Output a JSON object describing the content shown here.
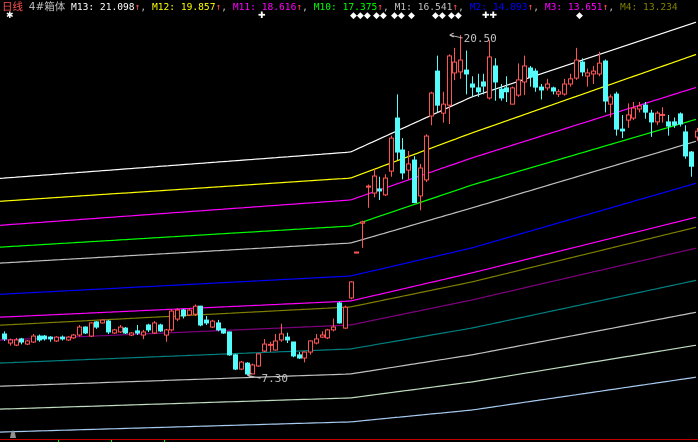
{
  "header": {
    "period": "日线",
    "indicator": "4#箱体",
    "arrow": "↑",
    "sep": ", ",
    "colors": {
      "period": "#ff5050",
      "indicator": "#c0c0c0",
      "arrow": "#ff5050"
    }
  },
  "markers": [
    "✱",
    "✚",
    "◆◆◆",
    "◆◆",
    "◆◆",
    "◆",
    "◆◆",
    "◆◆",
    "✚✚",
    "◆"
  ],
  "chart_data": {
    "type": "candlestick",
    "title": "日线 4#箱体",
    "ylim": [
      4.71,
      21.86
    ],
    "up_color": "#ff5454",
    "down_color": "#54fcfc",
    "annotations": [
      {
        "label": "20.50",
        "index": 77,
        "price": 20.5
      },
      {
        "label": "7.30",
        "index": 42,
        "price": 7.3
      }
    ],
    "candles": [
      [
        8.9,
        8.71,
        9.0,
        8.63
      ],
      [
        8.55,
        8.67,
        8.72,
        8.45
      ],
      [
        8.47,
        8.67,
        8.75,
        8.43
      ],
      [
        8.71,
        8.59,
        8.75,
        8.5
      ],
      [
        8.51,
        8.63,
        8.67,
        8.47
      ],
      [
        8.59,
        8.82,
        8.9,
        8.55
      ],
      [
        8.82,
        8.67,
        8.88,
        8.6
      ],
      [
        8.82,
        8.71,
        8.86,
        8.65
      ],
      [
        8.78,
        8.71,
        8.82,
        8.6
      ],
      [
        8.63,
        8.78,
        8.82,
        8.59
      ],
      [
        8.78,
        8.71,
        8.84,
        8.65
      ],
      [
        8.67,
        8.78,
        8.82,
        8.63
      ],
      [
        8.75,
        8.86,
        8.9,
        8.71
      ],
      [
        8.86,
        9.17,
        9.25,
        8.8
      ],
      [
        9.17,
        8.94,
        9.2,
        8.9
      ],
      [
        8.82,
        9.33,
        9.36,
        8.78
      ],
      [
        9.37,
        9.17,
        9.4,
        9.1
      ],
      [
        9.33,
        9.44,
        9.48,
        9.3
      ],
      [
        9.4,
        8.98,
        9.45,
        8.9
      ],
      [
        8.94,
        9.06,
        9.1,
        8.9
      ],
      [
        8.98,
        9.17,
        9.25,
        8.94
      ],
      [
        9.13,
        8.94,
        9.17,
        8.9
      ],
      [
        8.86,
        8.94,
        8.98,
        8.82
      ],
      [
        9.02,
        8.94,
        9.25,
        8.86
      ],
      [
        8.86,
        8.98,
        9.06,
        8.7
      ],
      [
        9.25,
        9.06,
        9.3,
        8.98
      ],
      [
        8.94,
        9.33,
        9.4,
        8.9
      ],
      [
        9.25,
        9.02,
        9.3,
        8.98
      ],
      [
        8.86,
        9.06,
        9.1,
        8.6
      ],
      [
        9.06,
        9.79,
        9.85,
        9.0
      ],
      [
        9.48,
        9.83,
        9.9,
        9.4
      ],
      [
        9.83,
        9.6,
        9.87,
        9.5
      ],
      [
        9.64,
        9.83,
        9.9,
        9.6
      ],
      [
        9.67,
        9.98,
        10.05,
        9.6
      ],
      [
        9.98,
        9.25,
        10.0,
        9.2
      ],
      [
        9.44,
        9.33,
        9.6,
        9.25
      ],
      [
        9.17,
        9.4,
        9.45,
        9.13
      ],
      [
        9.33,
        9.06,
        9.45,
        9.0
      ],
      [
        9.1,
        8.94,
        9.1,
        8.9
      ],
      [
        8.98,
        8.09,
        9.0,
        8.05
      ],
      [
        8.09,
        7.54,
        8.13,
        7.5
      ],
      [
        7.54,
        7.81,
        7.86,
        7.5
      ],
      [
        7.77,
        7.35,
        7.81,
        7.3
      ],
      [
        7.35,
        7.7,
        7.75,
        7.33
      ],
      [
        7.66,
        8.13,
        8.15,
        7.62
      ],
      [
        8.24,
        8.51,
        8.7,
        8.2
      ],
      [
        8.47,
        8.5,
        8.6,
        8.2
      ],
      [
        8.28,
        8.63,
        8.9,
        8.25
      ],
      [
        8.67,
        8.9,
        9.3,
        8.6
      ],
      [
        8.78,
        8.67,
        8.95,
        8.55
      ],
      [
        8.59,
        8.05,
        8.6,
        8.0
      ],
      [
        8.09,
        7.97,
        8.2,
        7.93
      ],
      [
        7.97,
        8.2,
        8.22,
        7.8
      ],
      [
        8.2,
        8.63,
        8.66,
        8.1
      ],
      [
        8.55,
        8.71,
        8.9,
        8.5
      ],
      [
        8.78,
        8.86,
        9.0,
        8.75
      ],
      [
        8.75,
        9.06,
        9.1,
        8.7
      ],
      [
        9.06,
        9.17,
        9.5,
        9.0
      ],
      [
        10.1,
        9.33,
        10.15,
        9.3
      ],
      [
        9.13,
        9.94,
        10.0,
        9.1
      ],
      [
        10.3,
        10.92,
        10.95,
        10.25
      ],
      [
        12.06,
        12.08,
        12.1,
        12.04
      ],
      [
        13.2,
        13.25,
        13.3,
        12.24
      ],
      [
        14.6,
        14.64,
        14.7,
        13.8
      ],
      [
        14.37,
        15.03,
        15.3,
        14.2
      ],
      [
        14.53,
        14.45,
        15.0,
        14.1
      ],
      [
        14.3,
        14.95,
        15.1,
        14.25
      ],
      [
        15.22,
        16.5,
        16.6,
        15.0
      ],
      [
        17.28,
        15.96,
        18.2,
        15.65
      ],
      [
        16.04,
        15.15,
        16.5,
        14.9
      ],
      [
        15.26,
        15.5,
        16.0,
        14.9
      ],
      [
        15.65,
        14.0,
        15.8,
        13.98
      ],
      [
        14.26,
        15.34,
        15.5,
        13.7
      ],
      [
        14.88,
        16.58,
        16.65,
        14.8
      ],
      [
        17.36,
        18.25,
        18.3,
        17.0
      ],
      [
        19.1,
        17.78,
        19.7,
        17.5
      ],
      [
        17.47,
        17.82,
        18.3,
        17.1
      ],
      [
        17.78,
        19.69,
        19.75,
        17.05
      ],
      [
        19.03,
        19.45,
        20.0,
        18.75
      ],
      [
        19.07,
        19.53,
        20.5,
        18.8
      ],
      [
        19.14,
        18.99,
        19.9,
        18.2
      ],
      [
        18.6,
        18.48,
        18.9,
        18.1
      ],
      [
        18.45,
        18.3,
        19.0,
        18.1
      ],
      [
        18.68,
        18.52,
        19.0,
        18.2
      ],
      [
        18.06,
        19.65,
        20.3,
        18.0
      ],
      [
        19.3,
        18.68,
        19.6,
        17.95
      ],
      [
        18.4,
        18.06,
        18.6,
        17.95
      ],
      [
        18.45,
        18.3,
        18.9,
        17.9
      ],
      [
        17.82,
        18.45,
        18.5,
        17.8
      ],
      [
        18.17,
        18.76,
        19.4,
        18.1
      ],
      [
        18.68,
        19.3,
        19.7,
        18.17
      ],
      [
        19.22,
        18.87,
        19.3,
        18.5
      ],
      [
        19.1,
        18.48,
        19.2,
        18.3
      ],
      [
        18.48,
        18.37,
        18.6,
        18.0
      ],
      [
        18.45,
        18.6,
        18.8,
        18.35
      ],
      [
        18.45,
        18.33,
        18.5,
        18.2
      ],
      [
        18.21,
        18.3,
        18.4,
        18.1
      ],
      [
        18.21,
        18.6,
        18.8,
        18.15
      ],
      [
        18.6,
        18.8,
        19.0,
        18.5
      ],
      [
        18.83,
        19.53,
        20.0,
        18.76
      ],
      [
        19.45,
        19.07,
        19.6,
        18.9
      ],
      [
        18.91,
        19.03,
        19.2,
        18.5
      ],
      [
        18.99,
        19.1,
        19.3,
        18.6
      ],
      [
        18.99,
        19.41,
        19.85,
        18.9
      ],
      [
        19.49,
        17.94,
        19.55,
        17.5
      ],
      [
        17.82,
        18.1,
        18.2,
        17.3
      ],
      [
        18.21,
        16.85,
        18.3,
        16.6
      ],
      [
        16.85,
        16.78,
        17.4,
        16.5
      ],
      [
        17.2,
        17.4,
        17.85,
        16.9
      ],
      [
        17.28,
        17.67,
        17.9,
        17.2
      ],
      [
        17.63,
        17.75,
        17.9,
        17.5
      ],
      [
        17.78,
        17.51,
        17.9,
        17.25
      ],
      [
        17.47,
        17.13,
        17.6,
        16.55
      ],
      [
        17.13,
        17.47,
        17.55,
        17.0
      ],
      [
        17.39,
        17.42,
        17.7,
        17.1
      ],
      [
        17.13,
        16.97,
        17.4,
        16.6
      ],
      [
        17.13,
        17.01,
        17.3,
        16.9
      ],
      [
        17.44,
        17.05,
        17.5,
        16.95
      ],
      [
        16.74,
        15.81,
        17.0,
        15.7
      ],
      [
        15.96,
        15.41,
        16.0,
        15.0
      ],
      [
        16.54,
        16.77,
        16.9,
        16.4
      ]
    ],
    "line_knot_indices": [
      0,
      60,
      81,
      120
    ],
    "series": [
      {
        "name": "M13",
        "value": "21.098",
        "color": "#ffffff",
        "values": [
          14.95,
          15.96,
          18.1,
          21.01
        ]
      },
      {
        "name": "M12",
        "value": "19.857",
        "color": "#ffff00",
        "values": [
          14.06,
          14.95,
          16.7,
          19.76
        ]
      },
      {
        "name": "M11",
        "value": "18.616",
        "color": "#ff00ff",
        "values": [
          13.13,
          14.1,
          15.73,
          18.48
        ]
      },
      {
        "name": "M10",
        "value": "17.375",
        "color": "#00ff00",
        "values": [
          12.28,
          13.09,
          14.68,
          17.24
        ]
      },
      {
        "name": "M1",
        "value": "16.541",
        "color": "#c0c0c0",
        "values": [
          11.66,
          12.43,
          13.79,
          16.39
        ]
      },
      {
        "name": "M2",
        "value": "14.893",
        "color": "#0000ff",
        "values": [
          10.45,
          11.15,
          12.24,
          14.76
        ]
      },
      {
        "name": "M3",
        "value": "13.651",
        "color": "#ff00ff",
        "values": [
          9.56,
          10.18,
          11.27,
          13.44
        ]
      },
      {
        "name": "M4",
        "value": "13.234",
        "color": "#808000",
        "values": [
          9.25,
          9.95,
          10.92,
          13.05
        ]
      },
      {
        "name": "M5",
        "color": "#800080",
        "values": [
          8.67,
          9.25,
          10.22,
          12.24
        ]
      },
      {
        "name": "M6",
        "color": "#008080",
        "values": [
          7.78,
          8.32,
          9.13,
          10.99
        ]
      },
      {
        "name": "M7",
        "color": "#c0c0c0",
        "values": [
          6.88,
          7.35,
          8.09,
          9.75
        ]
      },
      {
        "name": "M8",
        "color": "#c0dcc0",
        "values": [
          5.99,
          6.42,
          7.04,
          8.47
        ]
      },
      {
        "name": "M9",
        "color": "#a6caf0",
        "values": [
          5.1,
          5.49,
          5.95,
          7.23
        ]
      }
    ]
  }
}
